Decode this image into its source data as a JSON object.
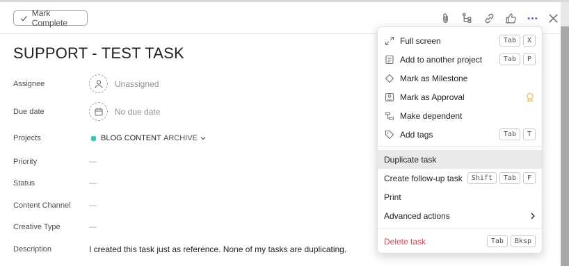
{
  "toolbar": {
    "mark_complete_label": "Mark Complete"
  },
  "task": {
    "title": "SUPPORT - TEST TASK",
    "fields": {
      "assignee_label": "Assignee",
      "assignee_value": "Unassigned",
      "due_date_label": "Due date",
      "due_date_value": "No due date",
      "projects_label": "Projects",
      "project_name": "BLOG CONTENT",
      "project_color": "#37c5ab",
      "project_section": "ARCHIVE",
      "priority_label": "Priority",
      "priority_value": "—",
      "status_label": "Status",
      "status_value": "—",
      "content_channel_label": "Content Channel",
      "content_channel_value": "—",
      "creative_type_label": "Creative Type",
      "creative_type_value": "—",
      "description_label": "Description",
      "description_value": "I created this task just as reference. None of my tasks are duplicating."
    }
  },
  "menu": {
    "items": [
      {
        "label": "Full screen",
        "icon": "expand-icon",
        "keys": [
          "Tab",
          "X"
        ]
      },
      {
        "label": "Add to another project",
        "icon": "project-add-icon",
        "keys": [
          "Tab",
          "P"
        ]
      },
      {
        "label": "Mark as Milestone",
        "icon": "diamond-icon",
        "keys": []
      },
      {
        "label": "Mark as Approval",
        "icon": "approval-icon",
        "keys": []
      },
      {
        "label": "Make dependent",
        "icon": "dependent-icon",
        "keys": []
      },
      {
        "label": "Add tags",
        "icon": "tag-icon",
        "keys": [
          "Tab",
          "T"
        ]
      },
      {
        "label": "Duplicate task",
        "keys": []
      },
      {
        "label": "Create follow-up task",
        "keys": [
          "Shift",
          "Tab",
          "F"
        ]
      },
      {
        "label": "Print",
        "keys": []
      },
      {
        "label": "Advanced actions",
        "keys": []
      },
      {
        "label": "Delete task",
        "keys": [
          "Tab",
          "Bksp"
        ]
      }
    ]
  },
  "colors": {
    "accent": "#4573d2",
    "danger": "#d1455a",
    "highlight": "#e8e9ea",
    "approval_badge": "#f1bd6c"
  }
}
